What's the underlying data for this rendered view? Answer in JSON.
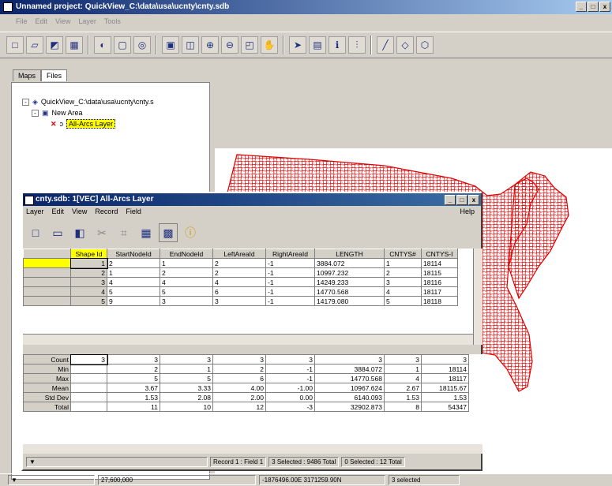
{
  "app": {
    "title": "Unnamed project: QuickView_C:\\data\\usa\\ucnty\\cnty.sdb"
  },
  "caption": {
    "min": "_",
    "max": "□",
    "close": "x"
  },
  "menu": [
    "File",
    "Edit",
    "View",
    "Layer",
    "Tools"
  ],
  "panel_tabs": [
    "Maps",
    "Files"
  ],
  "tree": {
    "root": "QuickView_C:\\data\\usa\\ucnty\\cnty.s",
    "area": "New Area",
    "layer": "All-Arcs Layer"
  },
  "window": {
    "title": "cnty.sdb: 1[VEC] All-Arcs Layer",
    "menu": [
      "Layer",
      "Edit",
      "View",
      "Record",
      "Field"
    ],
    "help": "Help",
    "columns": [
      "Shape Id",
      "StartNodeId",
      "EndNodeId",
      "LeftAreaId",
      "RightAreaId",
      "LENGTH",
      "CNTYS#",
      "CNTYS-I"
    ],
    "rows": [
      [
        "1",
        "2",
        "1",
        "2",
        "-1",
        "3884.072",
        "1",
        "18114"
      ],
      [
        "2",
        "1",
        "2",
        "2",
        "-1",
        "10997.232",
        "2",
        "18115"
      ],
      [
        "3",
        "4",
        "4",
        "4",
        "-1",
        "14249.233",
        "3",
        "18116"
      ],
      [
        "4",
        "5",
        "5",
        "6",
        "-1",
        "14770.568",
        "4",
        "18117"
      ],
      [
        "5",
        "9",
        "3",
        "3",
        "-1",
        "14179.080",
        "5",
        "18118"
      ]
    ],
    "stats": [
      {
        "label": "Count",
        "vals": [
          "3",
          "3",
          "3",
          "3",
          "3",
          "3",
          "3",
          "3"
        ]
      },
      {
        "label": "Min",
        "vals": [
          "",
          "2",
          "1",
          "2",
          "-1",
          "3884.072",
          "1",
          "18114"
        ]
      },
      {
        "label": "Max",
        "vals": [
          "",
          "5",
          "5",
          "6",
          "-1",
          "14770.568",
          "4",
          "18117"
        ]
      },
      {
        "label": "Mean",
        "vals": [
          "",
          "3.67",
          "3.33",
          "4.00",
          "-1.00",
          "10967.624",
          "2.67",
          "18115.67"
        ]
      },
      {
        "label": "Std Dev",
        "vals": [
          "",
          "1.53",
          "2.08",
          "2.00",
          "0.00",
          "6140.093",
          "1.53",
          "1.53"
        ]
      },
      {
        "label": "Total",
        "vals": [
          "",
          "11",
          "10",
          "12",
          "-3",
          "32902.873",
          "8",
          "54347"
        ]
      }
    ],
    "status": [
      "Record 1 : Field 1",
      "3 Selected : 9486 Total",
      "0 Selected : 12 Total"
    ]
  },
  "bottom": {
    "scale": "27,600,000",
    "coords": "-1876496.00E 3171259.90N",
    "selected": "3 selected"
  }
}
